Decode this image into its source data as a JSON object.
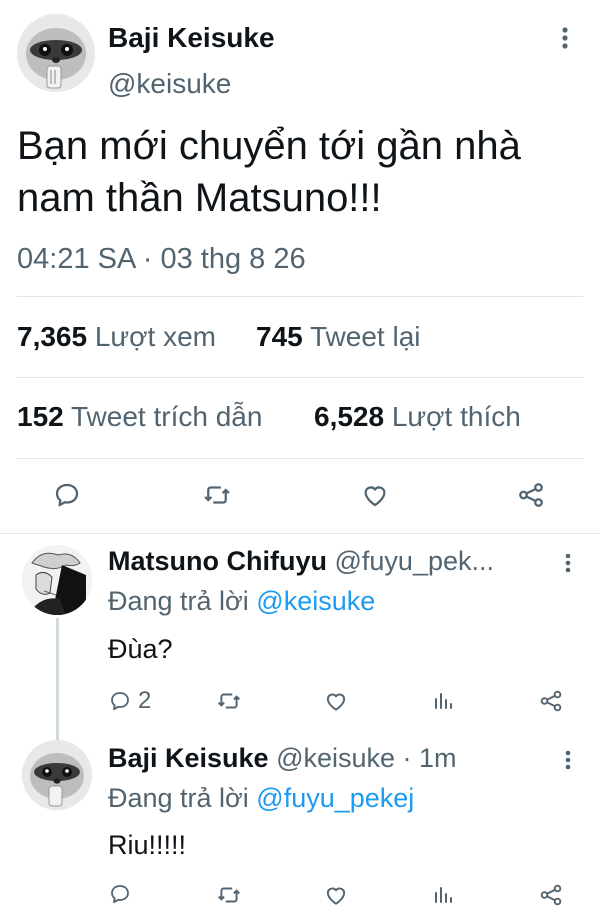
{
  "main_tweet": {
    "author_name": "Baji Keisuke",
    "author_handle": "@keisuke",
    "text_line1": "Bạn mới chuyển tới gần nhà",
    "text_line2": "nam thần Matsuno!!!",
    "timestamp": "04:21 SA · 03 thg 8 26",
    "stats": {
      "views_count": "7,365",
      "views_label": "Lượt xem",
      "retweets_count": "745",
      "retweets_label": "Tweet lại",
      "quotes_count": "152",
      "quotes_label": "Tweet trích dẫn",
      "likes_count": "6,528",
      "likes_label": "Lượt thích"
    }
  },
  "replies": [
    {
      "author_name": "Matsuno Chifuyu",
      "author_handle": "@fuyu_pek...",
      "replying_prefix": "Đang trả lời",
      "replying_to": "@keisuke",
      "text": "Đùa?",
      "reply_count": "2"
    },
    {
      "author_name": "Baji Keisuke",
      "author_handle": "@keisuke · 1m",
      "replying_prefix": "Đang trả lời",
      "replying_to": "@fuyu_pekej",
      "text": "Riu!!!!!"
    }
  ],
  "icons": {
    "reply": "reply-icon",
    "retweet": "retweet-icon",
    "like": "heart-icon",
    "share": "share-icon",
    "views": "analytics-icon",
    "more": "more-icon"
  },
  "colors": {
    "text": "#0f1419",
    "muted": "#536471",
    "link": "#1d9bf0",
    "divider": "#e1e6ea"
  }
}
